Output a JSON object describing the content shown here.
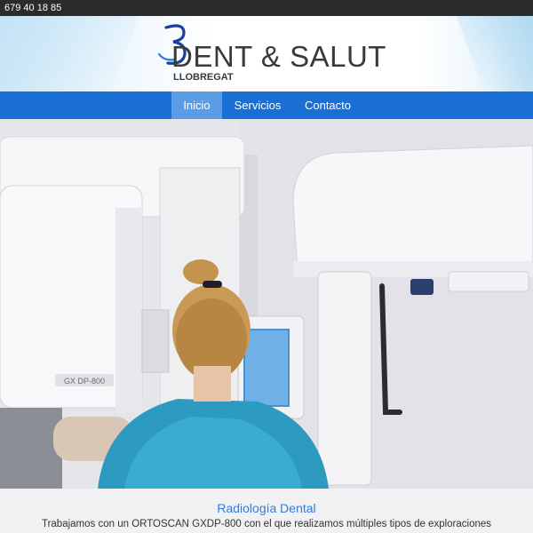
{
  "topbar": {
    "phone": "679 40 18 85"
  },
  "header": {
    "logo": {
      "name": "DENT & SALUT",
      "sub": "LLOBREGAT",
      "mark": "3"
    }
  },
  "nav": {
    "items": [
      {
        "label": "Inicio",
        "active": true
      },
      {
        "label": "Servicios",
        "active": false
      },
      {
        "label": "Contacto",
        "active": false
      }
    ]
  },
  "hero": {
    "device_label": "GX DP-800"
  },
  "content": {
    "title": "Radiología Dental",
    "text": "Trabajamos con un ORTOSCAN GXDP-800 con el que realizamos múltiples tipos de exploraciones"
  },
  "colors": {
    "topbar": "#2b2b2b",
    "nav": "#1a6fd6",
    "nav_active": "#5b9de5",
    "accent_text": "#2f7ed8"
  }
}
